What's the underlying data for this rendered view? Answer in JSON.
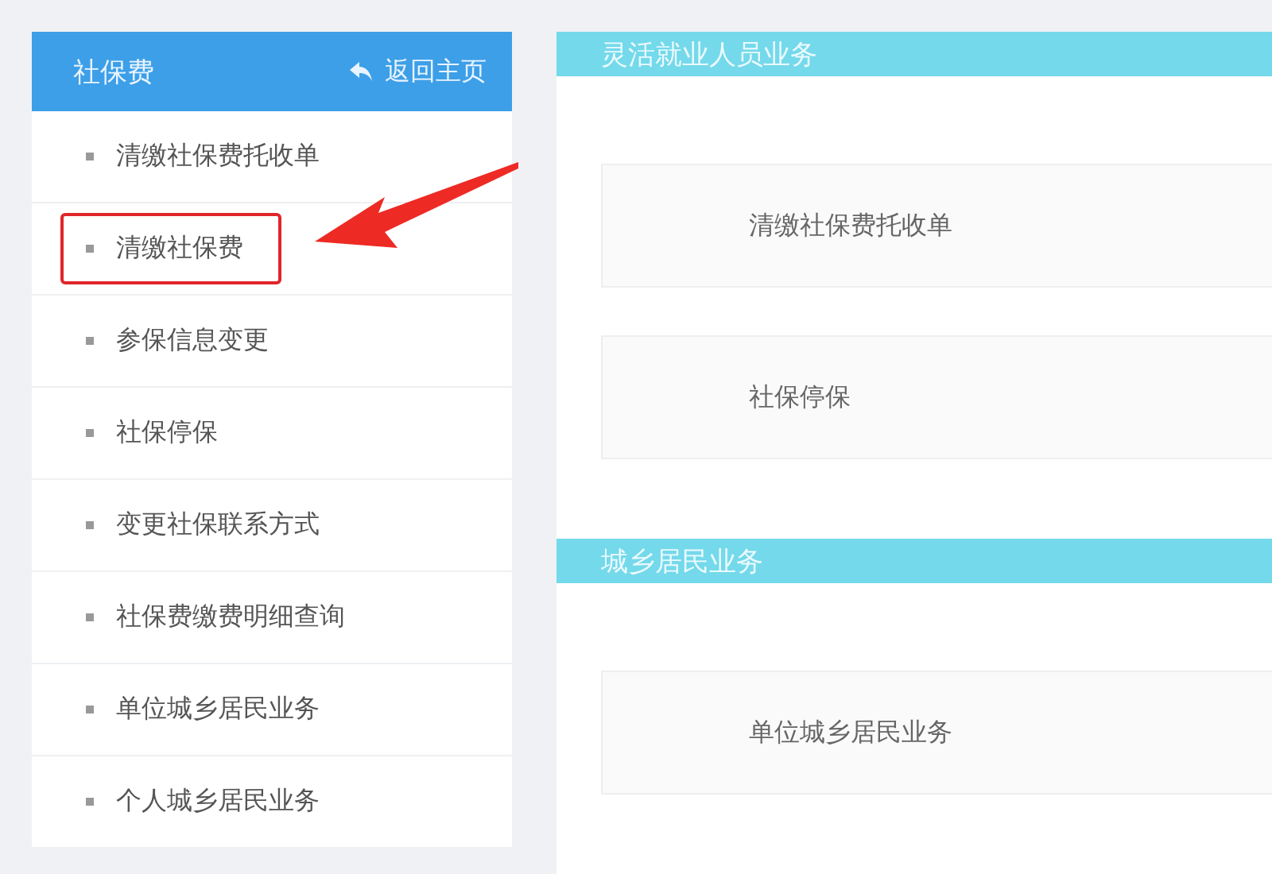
{
  "sidebar": {
    "title": "社保费",
    "back_link": "返回主页",
    "items": [
      {
        "label": "清缴社保费托收单",
        "selected": false
      },
      {
        "label": "清缴社保费",
        "selected": true
      },
      {
        "label": "参保信息变更",
        "selected": false
      },
      {
        "label": "社保停保",
        "selected": false
      },
      {
        "label": "变更社保联系方式",
        "selected": false
      },
      {
        "label": "社保费缴费明细查询",
        "selected": false
      },
      {
        "label": "单位城乡居民业务",
        "selected": false
      },
      {
        "label": "个人城乡居民业务",
        "selected": false
      }
    ]
  },
  "sections": [
    {
      "title": "灵活就业人员业务",
      "cards": [
        "清缴社保费托收单",
        "社保停保"
      ]
    },
    {
      "title": "城乡居民业务",
      "cards": [
        "单位城乡居民业务"
      ]
    }
  ]
}
